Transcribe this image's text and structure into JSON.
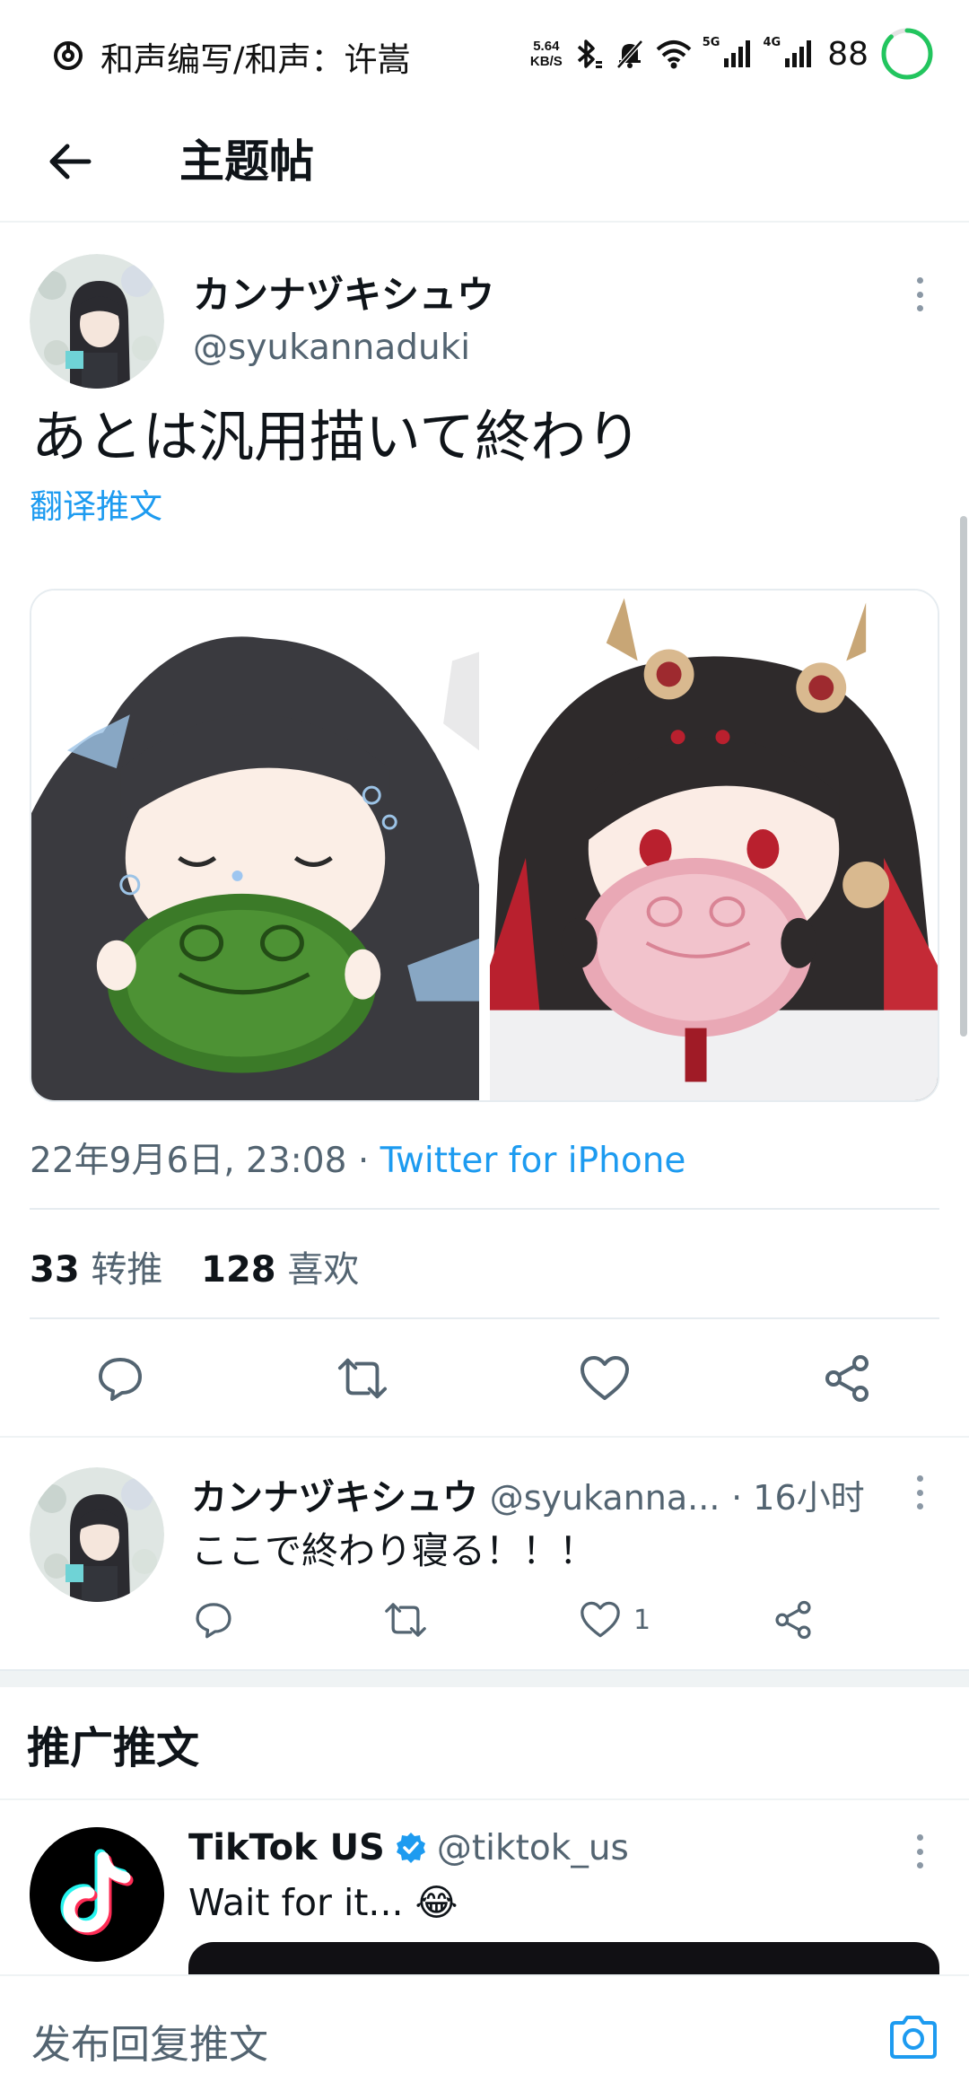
{
  "status_bar": {
    "notification_title": "和声编写/和声：许嵩",
    "net_speed_value": "5.64",
    "net_speed_unit": "KB/S",
    "net_5g": "5G",
    "net_4g": "4G",
    "battery_level": "88",
    "battery_percent": 88
  },
  "header": {
    "title": "主题帖"
  },
  "tweet": {
    "author_name": "カンナヅキシュウ",
    "author_handle": "@syukannaduki",
    "text": "あとは汎用描いて終わり",
    "translate_label": "翻译推文",
    "time": "22年9月6日, 23:08",
    "time_separator": " · ",
    "source": "Twitter for iPhone",
    "retweet_count": "33",
    "retweet_label": "转推",
    "like_count": "128",
    "like_label": "喜欢"
  },
  "reply": {
    "author_name": "カンナヅキシュウ",
    "author_handle": "@syukanna...",
    "time": "· 16小时",
    "text": "ここで終わり寝る！！！",
    "like_count": "1"
  },
  "promoted": {
    "section_title": "推广推文",
    "author_name": "TikTok US",
    "author_handle": "@tiktok_us",
    "text": "Wait for it... 😂"
  },
  "composer": {
    "placeholder": "发布回复推文"
  },
  "colors": {
    "accent": "#1d9bf0",
    "text_primary": "#0f1419",
    "text_secondary": "#536471",
    "divider": "#eff3f4",
    "battery_ring": "#22c55e"
  },
  "icons": {
    "back": "arrow-left-icon",
    "more": "more-vertical-icon",
    "reply": "reply-icon",
    "retweet": "retweet-icon",
    "like": "heart-icon",
    "share": "share-icon",
    "verified": "verified-badge-icon",
    "camera": "camera-icon"
  }
}
